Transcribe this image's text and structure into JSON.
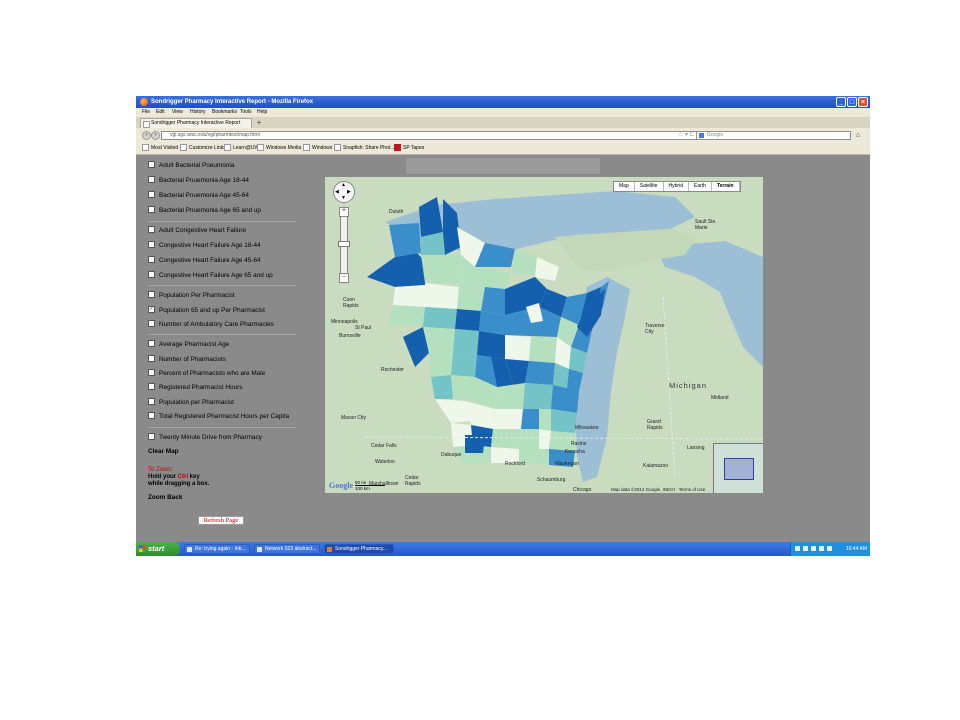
{
  "window": {
    "title": "Sondrigger Pharmacy Interactive Report - Mozilla Firefox"
  },
  "menu": [
    "File",
    "Edit",
    "View",
    "History",
    "Bookmarks",
    "Tools",
    "Help"
  ],
  "tab": {
    "label": "Sondrigger Pharmacy Interactive Report"
  },
  "url": "vgi.sgs.wisc.edu/vgi/pharmtest/map.html",
  "search_placeholder": "Google",
  "bookmarks": [
    "Most Visited",
    "Customize Links",
    "Learn@UW",
    "Windows Media",
    "Windows",
    "Snapfish: Share Phot...",
    "SP Tapes"
  ],
  "sidebar": {
    "groups": [
      [
        {
          "label": "Adult Bacterial Pneumonia",
          "checked": false
        },
        {
          "label": "Bacterial Pnuemonia Age 18-44",
          "checked": false
        },
        {
          "label": "Bacterial Pnuemonia Age 45-64",
          "checked": false
        },
        {
          "label": "Bacterial Pnuemonia Age 65 and up",
          "checked": false
        }
      ],
      [
        {
          "label": "Adult Congestive Heart Failure",
          "checked": false
        },
        {
          "label": "Congestive Heart Failure Age 18-44",
          "checked": false
        },
        {
          "label": "Congestive Heart Failure Age 45-64",
          "checked": false
        },
        {
          "label": "Congestive Heart Failure Age 65 and up",
          "checked": false
        }
      ],
      [
        {
          "label": "Population Per Pharmacist",
          "checked": false
        },
        {
          "label": "Population 65 and up Per Pharmacist",
          "checked": true
        },
        {
          "label": "Number of Ambulatory Care Pharmacies",
          "checked": false
        }
      ],
      [
        {
          "label": "Average Pharmacist Age",
          "checked": false
        },
        {
          "label": "Number of Pharmacists",
          "checked": false
        },
        {
          "label": "Percent of Pharmacists who are Male",
          "checked": false
        },
        {
          "label": "Registered Pharmacist Hours",
          "checked": false
        },
        {
          "label": "Population per Pharmacist",
          "checked": false
        },
        {
          "label": "Total Registered Pharmacist Hours per Capita",
          "checked": false
        }
      ],
      [
        {
          "label": "Twenty Minute Drive from Pharmacy",
          "checked": false
        }
      ]
    ],
    "clear_map": "Clear Map",
    "zoom_title": "To Zoom:",
    "zoom_line1_a": "Hold your ",
    "zoom_line1_ctrl": "Ctrl",
    "zoom_line1_b": " key",
    "zoom_line2": "while dragging a box.",
    "zoom_back": "Zoom Back",
    "refresh": "Refresh Page"
  },
  "map": {
    "types": [
      "Map",
      "Satellite",
      "Hybrid",
      "Earth",
      "Terrain"
    ],
    "active_type": "Terrain",
    "colors": {
      "water": "#9dbfd6",
      "land": "#c9dcc0",
      "c1": "#eef7ea",
      "c2": "#b5e0c0",
      "c3": "#74c3c7",
      "c4": "#3a8fcb",
      "c5": "#1560ae"
    },
    "places": {
      "duluth": "Duluth",
      "sault": "Sault Ste.\nMarie",
      "coon": "Coon\nRapids",
      "minneapolis": "Minneapolis",
      "stpaul": "St Paul",
      "burnsville": "Burnsville",
      "rochester": "Rochester",
      "mason": "Mason City",
      "cedarfalls": "Cedar Falls",
      "waterloo": "Waterloo",
      "cedarrapids": "Cedar\nRapids",
      "dubuque": "Dubuque",
      "rockford": "Rockford",
      "milwaukee": "Milwaukee",
      "racine": "Racine",
      "kenosha": "Kenosha",
      "waukegan": "Waukegan",
      "schaumburg": "Schaumburg",
      "chicago": "Chicago",
      "traverse": "Traverse\nCity",
      "michigan": "Michigan",
      "grand": "Grand\nRapids",
      "midland": "Midland",
      "kalamazoo": "Kalamazoo",
      "marshalltown": "Marshalltown",
      "lansing": "Lansing"
    },
    "scale_top": "50 mi",
    "scale_bottom": "100 km",
    "copyright": "Map data ©2012 Google, INEGI · Terms of Use",
    "logo": "Google"
  },
  "taskbar": {
    "start": "start",
    "tasks": [
      "Re: trying again - Inb...",
      "Network 023 abstract...",
      "Sondrigger Pharmacy..."
    ],
    "clock": "10:44 AM"
  }
}
